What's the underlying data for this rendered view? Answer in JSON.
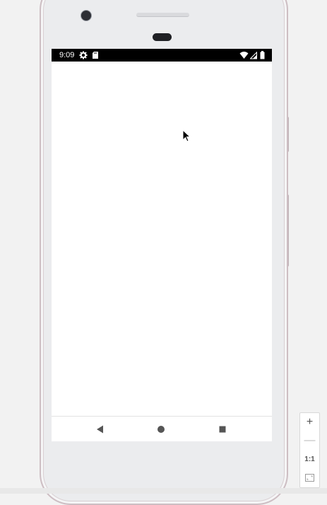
{
  "status_bar": {
    "time": "9:09",
    "icons": [
      "settings-icon",
      "sd-card-icon",
      "wifi-icon",
      "cell-signal-icon",
      "battery-icon"
    ]
  },
  "nav_bar": {
    "buttons": [
      "back-icon",
      "home-icon",
      "recents-icon"
    ]
  },
  "zoom_controls": {
    "zoom_in": "+",
    "zoom_out": "—",
    "reset": "1:1",
    "fit": "fit-screen-icon"
  },
  "colors": {
    "status_bar": "#000000",
    "screen": "#ffffff",
    "phone_body": "#ebecee",
    "phone_frame": "#cdbec3",
    "nav_icons": "#555555"
  }
}
